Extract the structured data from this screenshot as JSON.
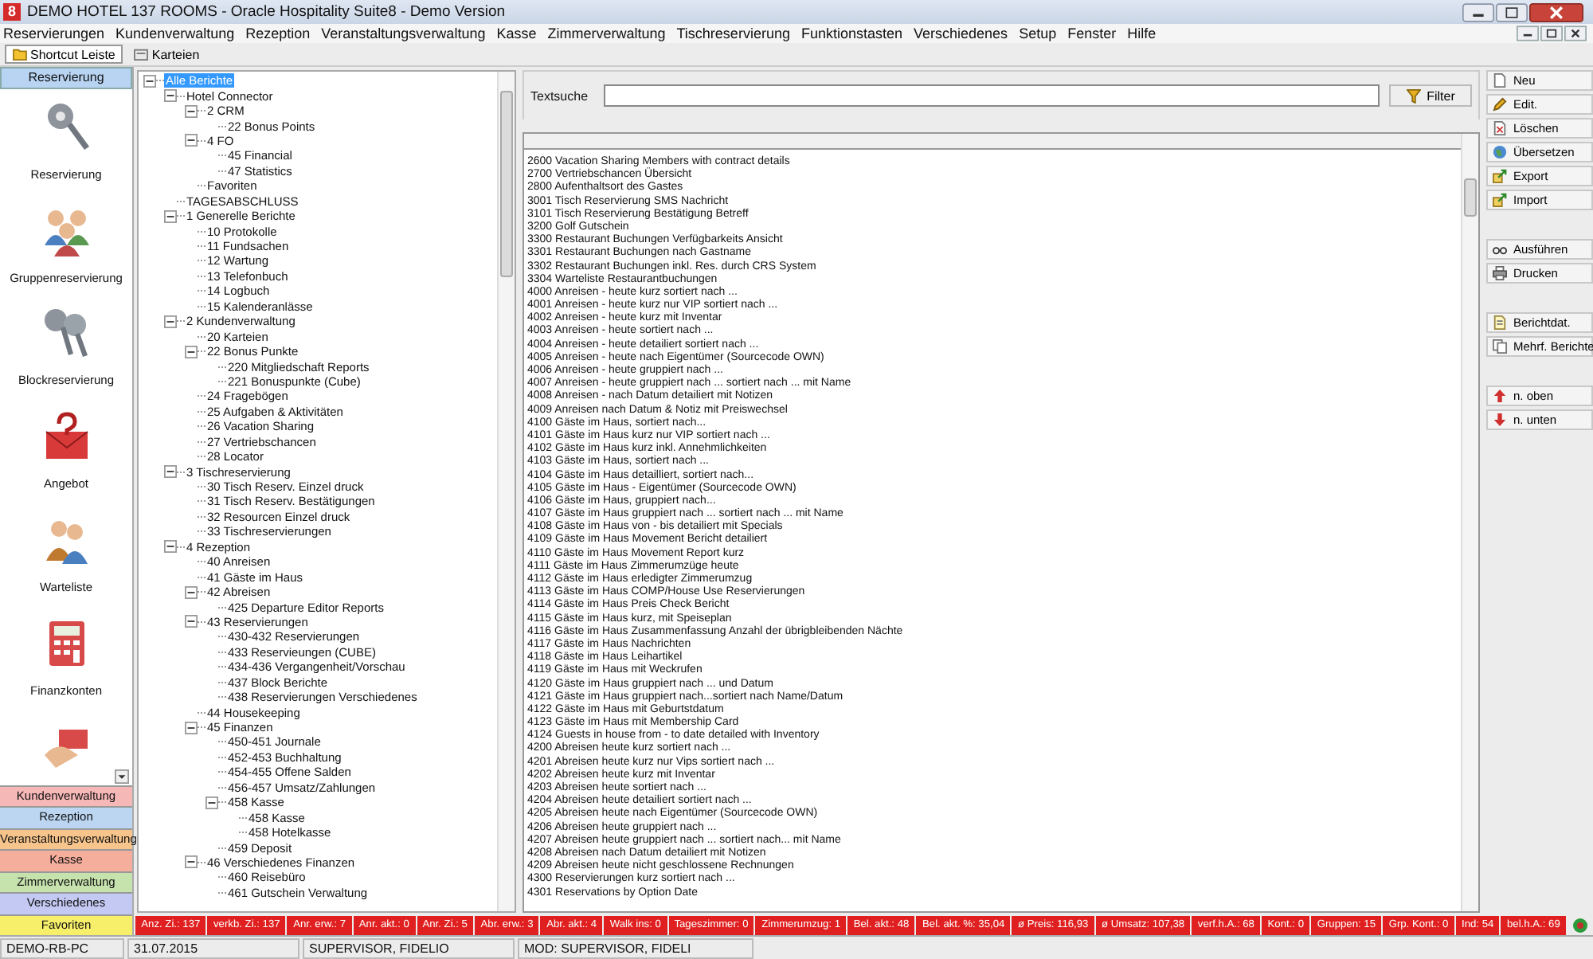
{
  "window": {
    "app_icon_label": "8",
    "title": "DEMO HOTEL 137 ROOMS - Oracle Hospitality Suite8 - Demo Version"
  },
  "menu": [
    "Reservierungen",
    "Kundenverwaltung",
    "Rezeption",
    "Veranstaltungsverwaltung",
    "Kasse",
    "Zimmerverwaltung",
    "Tischreservierung",
    "Funktionstasten",
    "Verschiedenes",
    "Setup",
    "Fenster",
    "Hilfe"
  ],
  "toolbar": [
    {
      "label": "Shortcut Leiste",
      "selected": true
    },
    {
      "label": "Karteien",
      "selected": false
    }
  ],
  "sidebar": {
    "header": "Reservierung",
    "items": [
      "Reservierung",
      "Gruppenreservierung",
      "Blockreservierung",
      "Angebot",
      "Warteliste",
      "Finanzkonten"
    ],
    "modules": [
      {
        "label": "Kundenverwaltung",
        "color": "#f6b7b7"
      },
      {
        "label": "Rezeption",
        "color": "#bcd6f2"
      },
      {
        "label": "Veranstaltungsverwaltung",
        "color": "#f7c58c"
      },
      {
        "label": "Kasse",
        "color": "#f5ad9c"
      },
      {
        "label": "Zimmerverwaltung",
        "color": "#c6e2ad"
      },
      {
        "label": "Verschiedenes",
        "color": "#c3c9f2"
      },
      {
        "label": "Favoriten",
        "color": "#f7ef6a"
      }
    ]
  },
  "tree": [
    {
      "label": "Alle Berichte",
      "selected": true,
      "expanded": true,
      "children": [
        {
          "label": "Hotel Connector",
          "selected": false,
          "expanded": true,
          "children": [
            {
              "label": "2 CRM",
              "selected": false,
              "expanded": true,
              "children": [
                {
                  "label": "22 Bonus Points",
                  "selected": false
                }
              ]
            },
            {
              "label": "4 FO",
              "selected": false,
              "expanded": true,
              "children": [
                {
                  "label": "45 Financial",
                  "selected": false
                },
                {
                  "label": "47 Statistics",
                  "selected": false
                }
              ]
            },
            {
              "label": "Favoriten",
              "selected": false
            }
          ]
        },
        {
          "label": "TAGESABSCHLUSS",
          "selected": false
        },
        {
          "label": "1 Generelle Berichte",
          "selected": false,
          "expanded": true,
          "children": [
            {
              "label": "10 Protokolle",
              "selected": false
            },
            {
              "label": "11 Fundsachen",
              "selected": false
            },
            {
              "label": "12 Wartung",
              "selected": false
            },
            {
              "label": "13 Telefonbuch",
              "selected": false
            },
            {
              "label": "14 Logbuch",
              "selected": false
            },
            {
              "label": "15 Kalenderanlässe",
              "selected": false
            }
          ]
        },
        {
          "label": "2 Kundenverwaltung",
          "selected": false,
          "expanded": true,
          "children": [
            {
              "label": "20 Karteien",
              "selected": false
            },
            {
              "label": "22 Bonus Punkte",
              "selected": false,
              "expanded": true,
              "children": [
                {
                  "label": "220 Mitgliedschaft Reports",
                  "selected": false
                },
                {
                  "label": "221 Bonuspunkte (Cube)",
                  "selected": false
                }
              ]
            },
            {
              "label": "24 Fragebögen",
              "selected": false
            },
            {
              "label": "25 Aufgaben & Aktivitäten",
              "selected": false
            },
            {
              "label": "26 Vacation Sharing",
              "selected": false
            },
            {
              "label": "27 Vertriebschancen",
              "selected": false
            },
            {
              "label": "28 Locator",
              "selected": false
            }
          ]
        },
        {
          "label": "3 Tischreservierung",
          "selected": false,
          "expanded": true,
          "children": [
            {
              "label": "30 Tisch Reserv. Einzel druck",
              "selected": false
            },
            {
              "label": "31 Tisch Reserv. Bestätigungen",
              "selected": false
            },
            {
              "label": "32 Resourcen Einzel druck",
              "selected": false
            },
            {
              "label": "33 Tischreservierungen",
              "selected": false
            }
          ]
        },
        {
          "label": "4 Rezeption",
          "selected": false,
          "expanded": true,
          "children": [
            {
              "label": "40 Anreisen",
              "selected": false
            },
            {
              "label": "41 Gäste im Haus",
              "selected": false
            },
            {
              "label": "42 Abreisen",
              "selected": false,
              "expanded": true,
              "children": [
                {
                  "label": "425 Departure Editor Reports",
                  "selected": false
                }
              ]
            },
            {
              "label": "43 Reservierungen",
              "selected": false,
              "expanded": true,
              "children": [
                {
                  "label": "430-432 Reservierungen",
                  "selected": false
                },
                {
                  "label": "433 Reservieungen (CUBE)",
                  "selected": false
                },
                {
                  "label": "434-436 Vergangenheit/Vorschau",
                  "selected": false
                },
                {
                  "label": "437 Block Berichte",
                  "selected": false
                },
                {
                  "label": "438 Reservierungen Verschiedenes",
                  "selected": false
                }
              ]
            },
            {
              "label": "44 Housekeeping",
              "selected": false
            },
            {
              "label": "45 Finanzen",
              "selected": false,
              "expanded": true,
              "children": [
                {
                  "label": "450-451 Journale",
                  "selected": false
                },
                {
                  "label": "452-453 Buchhaltung",
                  "selected": false
                },
                {
                  "label": "454-455 Offene Salden",
                  "selected": false
                },
                {
                  "label": "456-457 Umsatz/Zahlungen",
                  "selected": false
                },
                {
                  "label": "458 Kasse",
                  "selected": false,
                  "expanded": true,
                  "children": [
                    {
                      "label": "458 Kasse",
                      "selected": false
                    },
                    {
                      "label": "458 Hotelkasse",
                      "selected": false
                    }
                  ]
                },
                {
                  "label": "459 Deposit",
                  "selected": false
                }
              ]
            },
            {
              "label": "46 Verschiedenes Finanzen",
              "selected": false,
              "expanded": true,
              "children": [
                {
                  "label": "460 Reisebüro",
                  "selected": false
                },
                {
                  "label": "461 Gutschein Verwaltung",
                  "selected": false
                }
              ]
            }
          ]
        }
      ]
    }
  ],
  "search": {
    "label": "Textsuche",
    "filter_button": "Filter"
  },
  "reports": [
    "2600 Vacation Sharing Members with contract details",
    "2700 Vertriebschancen Übersicht",
    "2800 Aufenthaltsort des Gastes",
    "3001 Tisch Reservierung SMS Nachricht",
    "3101 Tisch Reservierung Bestätigung Betreff",
    "3200 Golf Gutschein",
    "3300 Restaurant Buchungen Verfügbarkeits Ansicht",
    "3301 Restaurant Buchungen nach Gastname",
    "3302 Restaurant Buchungen inkl. Res. durch CRS System",
    "3304 Warteliste Restaurantbuchungen",
    "4000 Anreisen - heute kurz sortiert nach ...",
    "4001 Anreisen - heute kurz nur VIP sortiert nach ...",
    "4002 Anreisen - heute kurz mit Inventar",
    "4003 Anreisen - heute sortiert nach ...",
    "4004 Anreisen - heute detailiert sortiert nach ...",
    "4005 Anreisen - heute nach Eigentümer (Sourcecode OWN)",
    "4006 Anreisen - heute gruppiert nach ...",
    "4007 Anreisen - heute gruppiert nach ... sortiert nach ... mit Name",
    "4008 Anreisen - nach Datum detailiert mit Notizen",
    "4009 Anreisen nach Datum & Notiz mit Preiswechsel",
    "4100 Gäste im Haus, sortiert nach...",
    "4101 Gäste im Haus kurz nur VIP sortiert nach ...",
    "4102 Gäste im Haus kurz inkl. Annehmlichkeiten",
    "4103 Gäste im Haus, sortiert nach ...",
    "4104 Gäste im Haus detailliert, sortiert nach...",
    "4105 Gäste im Haus - Eigentümer (Sourcecode OWN)",
    "4106 Gäste im Haus, gruppiert nach...",
    "4107 Gäste im Haus gruppiert nach ... sortiert nach ... mit Name",
    "4108 Gäste im Haus von - bis detailiert mit Specials",
    "4109 Gäste im Haus Movement Bericht detailiert",
    "4110 Gäste im Haus Movement Report kurz",
    "4111 Gäste im Haus Zimmerumzüge heute",
    "4112 Gäste im Haus erledigter Zimmerumzug",
    "4113 Gäste im Haus COMP/House Use Reservierungen",
    "4114 Gäste im Haus Preis Check Bericht",
    "4115 Gäste im Haus kurz, mit Speiseplan",
    "4116 Gäste im Haus Zusammenfassung Anzahl der übrigbleibenden Nächte",
    "4117 Gäste im Haus Nachrichten",
    "4118 Gäste im Haus Leihartikel",
    "4119 Gäste im Haus mit Weckrufen",
    "4120 Gäste im Haus gruppiert nach ... und Datum",
    "4121 Gäste im Haus gruppiert nach...sortiert nach Name/Datum",
    "4122 Gäste im Haus mit Geburtstdatum",
    "4123 Gäste im Haus mit Membership Card",
    "4124 Guests in house from - to date detailed with Inventory",
    "4200 Abreisen heute kurz sortiert nach ...",
    "4201 Abreisen heute kurz nur Vips sortiert nach ...",
    "4202 Abreisen heute kurz mit Inventar",
    "4203 Abreisen heute sortiert nach ...",
    "4204 Abreisen heute detailiert sortiert nach ...",
    "4205 Abreisen heute nach Eigentümer (Sourcecode OWN)",
    "4206 Abreisen heute gruppiert nach ...",
    "4207 Abreisen heute gruppiert nach ... sortiert nach... mit Name",
    "4208 Abreisen nach Datum detailiert mit Notizen",
    "4209 Abreisen heute nicht geschlossene Rechnungen",
    "4300 Reservierungen kurz sortiert nach ...",
    "4301 Reservations by Option Date"
  ],
  "action_groups": [
    [
      {
        "label": "Neu",
        "kind": "new"
      },
      {
        "label": "Edit.",
        "kind": "edit"
      },
      {
        "label": "Löschen",
        "kind": "delete"
      },
      {
        "label": "Übersetzen",
        "kind": "translate"
      },
      {
        "label": "Export",
        "kind": "export"
      },
      {
        "label": "Import",
        "kind": "import"
      }
    ],
    [
      {
        "label": "Ausführen",
        "kind": "run"
      },
      {
        "label": "Drucken",
        "kind": "print"
      }
    ],
    [
      {
        "label": "Berichtdat.",
        "kind": "reportfile"
      },
      {
        "label": "Mehrf. Berichte",
        "kind": "multi"
      }
    ],
    [
      {
        "label": "n. oben",
        "kind": "up"
      },
      {
        "label": "n. unten",
        "kind": "down"
      }
    ]
  ],
  "stats": [
    "Anz. Zi.: 137",
    "verkb. Zi.: 137",
    "Anr. erw.: 7",
    "Anr. akt.: 0",
    "Anr. Zi.: 5",
    "Abr. erw.: 3",
    "Abr. akt.: 4",
    "Walk ins: 0",
    "Tageszimmer: 0",
    "Zimmerumzug: 1",
    "Bel. akt.: 48",
    "Bel. akt. %: 35,04",
    "ø Preis: 116,93",
    "ø Umsatz: 107,38",
    "verf.h.A.: 68",
    "Kont.: 0",
    "Gruppen: 15",
    "Grp. Kont.: 0",
    "Ind: 54",
    "bel.h.A.: 69"
  ],
  "status_bar": [
    "DEMO-RB-PC",
    "31.07.2015",
    "SUPERVISOR, FIDELIO",
    "MOD: SUPERVISOR, FIDELI"
  ]
}
